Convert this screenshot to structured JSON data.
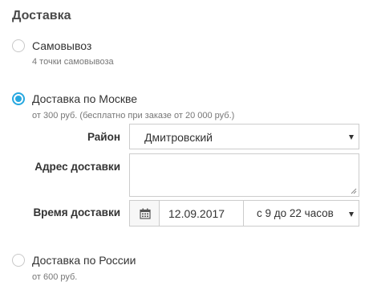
{
  "section_title": "Доставка",
  "options": [
    {
      "label": "Самовывоз",
      "subtitle": "4 точки самовывоза",
      "selected": false
    },
    {
      "label": "Доставка по Москве",
      "subtitle": "от 300 руб. (бесплатно при заказе от 20 000 руб.)",
      "selected": true
    },
    {
      "label": "Доставка по России",
      "subtitle": "от 600 руб.",
      "selected": false
    }
  ],
  "moscow_form": {
    "district_label": "Район",
    "district_value": "Дмитровский",
    "address_label": "Адрес доставки",
    "address_value": "",
    "time_label": "Время доставки",
    "date_value": "12.09.2017",
    "time_slot_value": "с 9 до 22 часов"
  },
  "colors": {
    "accent": "#27a8e0",
    "border": "#cccccc"
  },
  "icons": {
    "calendar": "calendar-icon",
    "dropdown": "chevron-down-icon"
  }
}
